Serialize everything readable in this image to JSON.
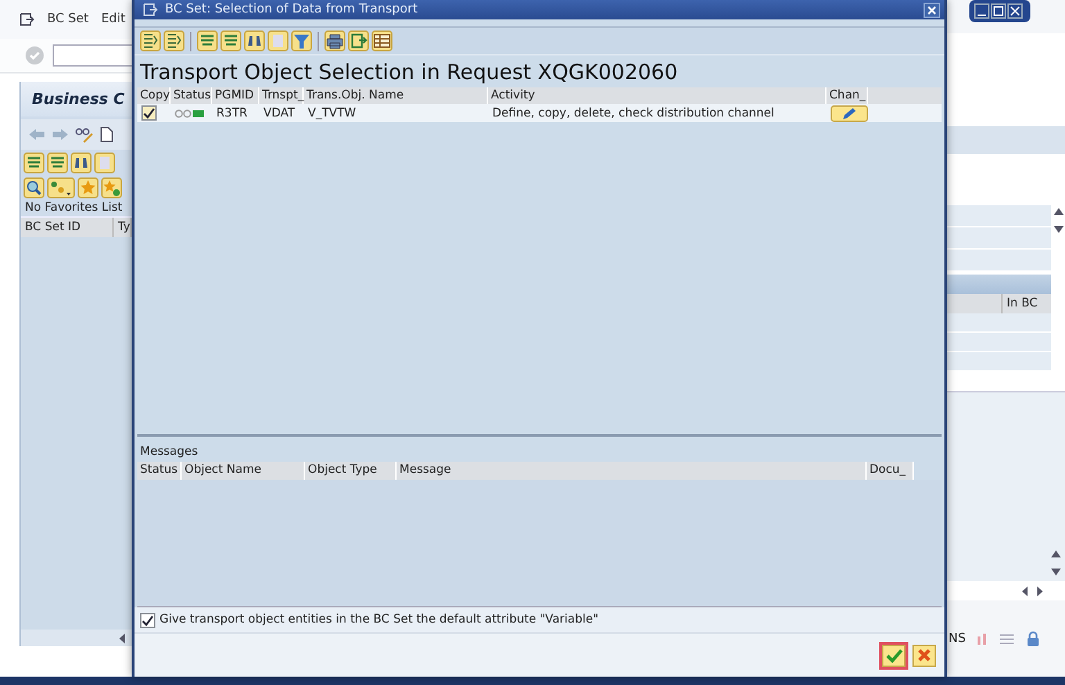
{
  "background": {
    "menu": [
      {
        "label": "BC Set"
      },
      {
        "label": "Edit"
      }
    ],
    "panel_title": "Business C",
    "favorites_note": "No Favorites List",
    "columns": [
      "BC Set ID",
      "Ty"
    ],
    "right_columns": [
      "In BC"
    ],
    "status_text": "NS"
  },
  "dialog": {
    "title": "BC Set: Selection of Data from Transport",
    "heading": "Transport Object Selection in Request XQGK002060",
    "table": {
      "columns": [
        "Copy",
        "Status",
        "PGMID",
        "Trnspt_",
        "Trans.Obj. Name",
        "Activity",
        "Chan_"
      ],
      "rows": [
        {
          "copy": true,
          "pgmid": "R3TR",
          "trnspt": "VDAT",
          "name": "V_TVTW",
          "activity": "Define, copy, delete, check distribution channel"
        }
      ]
    },
    "messages": {
      "label": "Messages",
      "columns": [
        "Status",
        "Object Name",
        "Object Type",
        "Message",
        "Docu_"
      ]
    },
    "option": {
      "label": "Give transport object entities in the BC Set the default attribute \"Variable\"",
      "checked": true
    }
  }
}
